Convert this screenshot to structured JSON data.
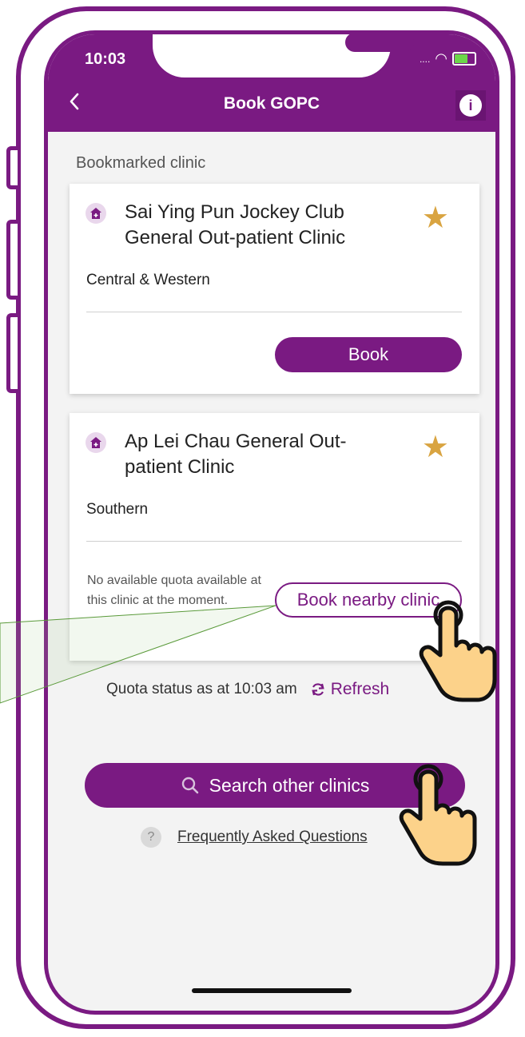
{
  "status_bar": {
    "time": "10:03",
    "signal": "....",
    "wifi_icon": "wifi-icon",
    "battery_icon": "battery-icon"
  },
  "header": {
    "title": "Book GOPC",
    "back_icon": "chevron-left-icon",
    "info_icon": "info-icon",
    "info_symbol": "i"
  },
  "section_label": "Bookmarked clinic",
  "clinics": [
    {
      "name": "Sai Ying Pun Jockey Club General Out-patient Clinic",
      "district": "Central & Western",
      "action_label": "Book",
      "bookmarked": true
    },
    {
      "name": "Ap Lei Chau General Out-patient Clinic",
      "district": "Southern",
      "no_quota_message": "No available quota available at this clinic at the moment.",
      "action_label": "Book nearby clinic",
      "bookmarked": true
    }
  ],
  "quota_status": {
    "text": "Quota status as at 10:03 am",
    "refresh_label": "Refresh"
  },
  "search_button": {
    "label": "Search other clinics"
  },
  "faq": {
    "icon_symbol": "?",
    "label": "Frequently Asked Questions"
  },
  "colors": {
    "brand": "#7a1a82",
    "star": "#d9a441",
    "background": "#f3f3f3"
  }
}
